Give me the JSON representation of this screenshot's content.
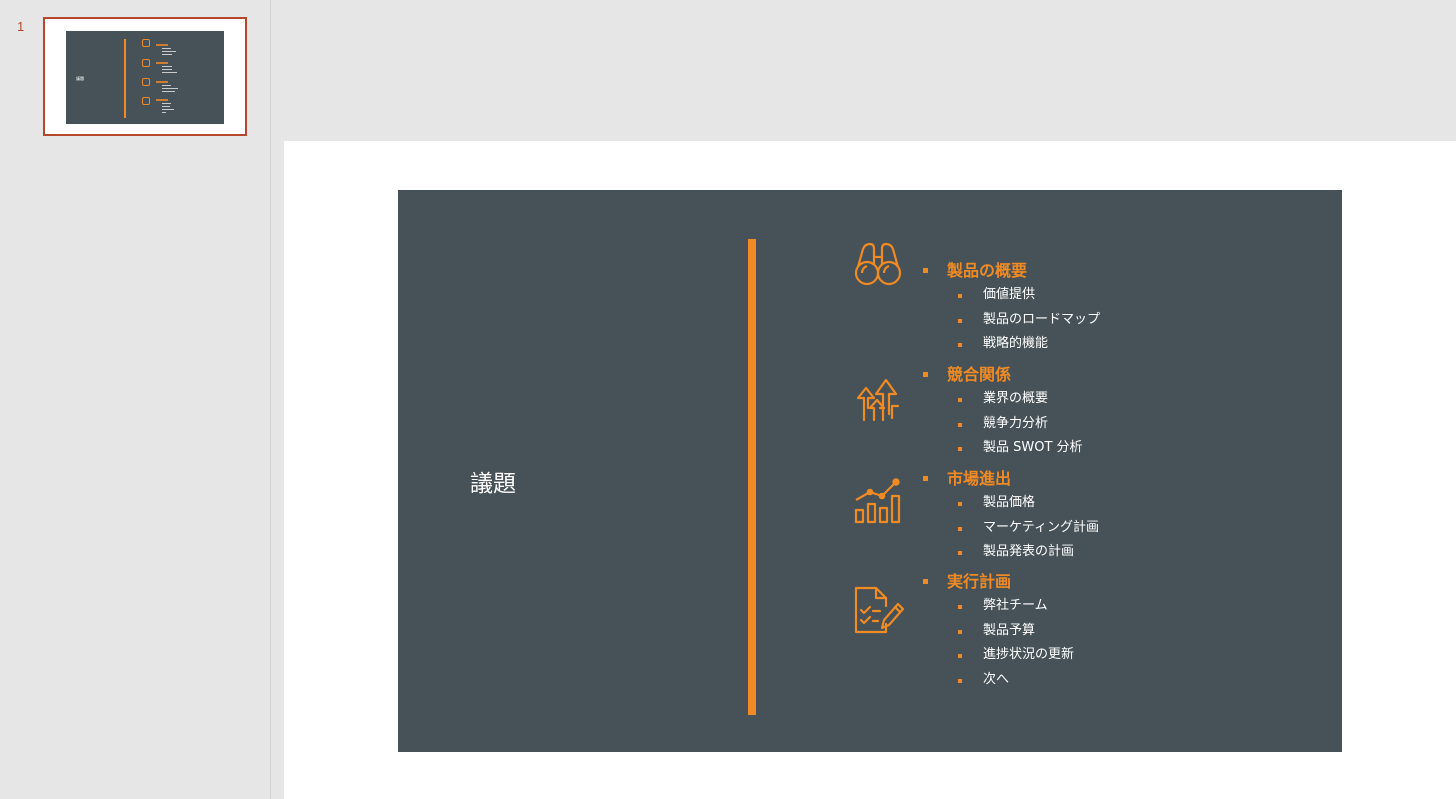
{
  "thumbnail_panel": {
    "slide_number": "1",
    "thumb_title": "議題"
  },
  "slide": {
    "title": "議題",
    "sections": [
      {
        "icon": "binoculars-icon",
        "heading": "製品の概要",
        "items": [
          "価値提供",
          "製品のロードマップ",
          "戦略的機能"
        ]
      },
      {
        "icon": "growth-arrows-icon",
        "heading": "競合関係",
        "items": [
          "業界の概要",
          "競争力分析",
          "製品 SWOT 分析"
        ]
      },
      {
        "icon": "bar-chart-trend-icon",
        "heading": "市場進出",
        "items": [
          "製品価格",
          "マーケティング計画",
          "製品発表の計画"
        ]
      },
      {
        "icon": "checklist-pencil-icon",
        "heading": "実行計画",
        "items": [
          "弊社チーム",
          "製品予算",
          "進捗状況の更新",
          "次へ"
        ]
      }
    ]
  },
  "colors": {
    "slide_bg": "#465257",
    "accent": "#f08a24",
    "selection": "#b5472c"
  }
}
